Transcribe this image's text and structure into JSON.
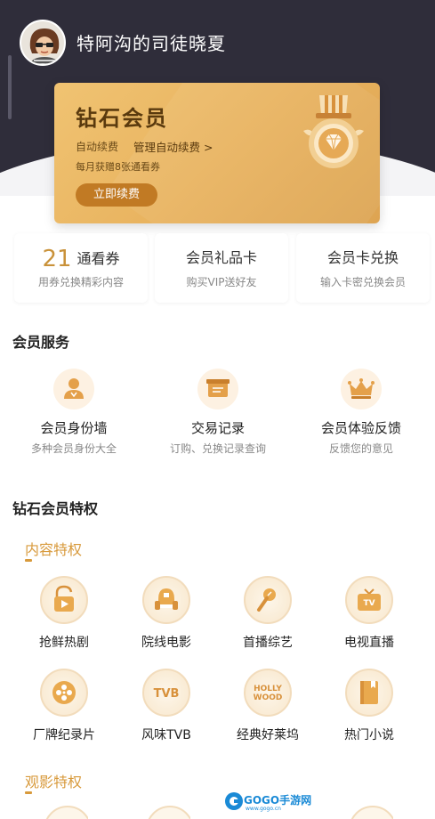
{
  "header": {
    "username": "特阿沟的司徒晓夏"
  },
  "vip_card": {
    "title": "钻石会员",
    "renew_label": "自动续费",
    "manage_link": "管理自动续费 >",
    "monthly_note": "每月获赠8张通看券",
    "renew_button": "立即续费"
  },
  "quick_cards": [
    {
      "count": "21",
      "title": "通看券",
      "sub": "用券兑换精彩内容"
    },
    {
      "title": "会员礼品卡",
      "sub": "购买VIP送好友"
    },
    {
      "title": "会员卡兑换",
      "sub": "输入卡密兑换会员"
    }
  ],
  "services": {
    "title": "会员服务",
    "items": [
      {
        "label": "会员身份墙",
        "sub": "多种会员身份大全",
        "icon": "member-badge-icon"
      },
      {
        "label": "交易记录",
        "sub": "订购、兑换记录查询",
        "icon": "transaction-box-icon"
      },
      {
        "label": "会员体验反馈",
        "sub": "反馈您的意见",
        "icon": "crown-icon"
      }
    ]
  },
  "privileges": {
    "title": "钻石会员特权",
    "content_title": "内容特权",
    "content_items": [
      {
        "label": "抢鲜热剧",
        "icon": "play-lock-icon"
      },
      {
        "label": "院线电影",
        "icon": "cinema-seat-icon"
      },
      {
        "label": "首播综艺",
        "icon": "microphone-icon"
      },
      {
        "label": "电视直播",
        "icon": "tv-icon"
      },
      {
        "label": "厂牌纪录片",
        "icon": "film-reel-icon"
      },
      {
        "label": "风味TVB",
        "icon": "tvb-icon",
        "icon_text": "TVB"
      },
      {
        "label": "经典好莱坞",
        "icon": "hollywood-icon",
        "icon_text": "HOLLY WOOD"
      },
      {
        "label": "热门小说",
        "icon": "book-icon"
      }
    ],
    "viewing_title": "观影特权"
  },
  "watermark": {
    "text": "GOGO手游网",
    "sub": "www.gogo.cn"
  },
  "colors": {
    "header_dark": "#2f2d3a",
    "gold": "#e8b25e",
    "accent": "#d89a3c",
    "button": "#c17a24"
  }
}
